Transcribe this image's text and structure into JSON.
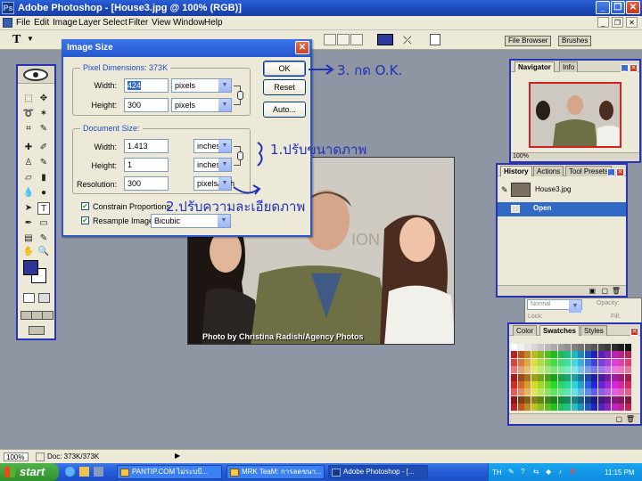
{
  "window": {
    "title": "Adobe Photoshop - [House3.jpg @ 100% (RGB)]"
  },
  "menu": [
    "File",
    "Edit",
    "Image",
    "Layer",
    "Select",
    "Filter",
    "View",
    "Window",
    "Help"
  ],
  "options": {
    "wells": [
      "File Browser",
      "Brushes"
    ]
  },
  "dialog": {
    "title": "Image Size",
    "pixel_dimensions_label": "Pixel Dimensions:",
    "pixel_dimensions_value": "373K",
    "width_label": "Width:",
    "width_px": "424",
    "width_px_unit": "pixels",
    "height_label": "Height:",
    "height_px": "300",
    "height_px_unit": "pixels",
    "document_size_label": "Document Size:",
    "doc_width_label": "Width:",
    "doc_width": "1.413",
    "doc_width_unit": "inches",
    "doc_height_label": "Height:",
    "doc_height": "1",
    "doc_height_unit": "inches",
    "resolution_label": "Resolution:",
    "resolution": "300",
    "resolution_unit": "pixels/inch",
    "constrain_label": "Constrain Proportions",
    "resample_label": "Resample Image:",
    "resample_method": "Bicubic",
    "ok": "OK",
    "reset": "Reset",
    "auto": "Auto..."
  },
  "annotations": {
    "step1": "1.ปรับขนาดภาพ",
    "step2": "2.ปรับความละเอียดภาพ",
    "step3": "3. กด O.K."
  },
  "photo": {
    "caption": "Photo by Christina Radish/Agency Photos",
    "wall_text": "ION"
  },
  "navigator": {
    "tabs": [
      "Navigator",
      "Info"
    ],
    "zoom": "100%"
  },
  "history": {
    "tabs": [
      "History",
      "Actions",
      "Tool Presets"
    ],
    "snapshot": "House3.jpg",
    "step": "Open"
  },
  "layers": {
    "mode": "Normal",
    "opacity_label": "Opacity:",
    "lock_label": "Lock:",
    "fill_label": "Fill:"
  },
  "swatches": {
    "tabs": [
      "Color",
      "Swatches",
      "Styles"
    ]
  },
  "status": {
    "zoom": "100%",
    "doc": "Doc: 373K/373K"
  },
  "taskbar": {
    "start": "start",
    "tasks": [
      "PANTIP.COM ไม่ระบบี...",
      "MRK TeaM: การลดขนา...",
      "Adobe Photoshop - [..."
    ],
    "lang": "TH",
    "time": "11:15 PM"
  },
  "colors": {
    "accent": "#2833b5",
    "annotation": "#2231b9",
    "foreground": "#2c3592"
  }
}
